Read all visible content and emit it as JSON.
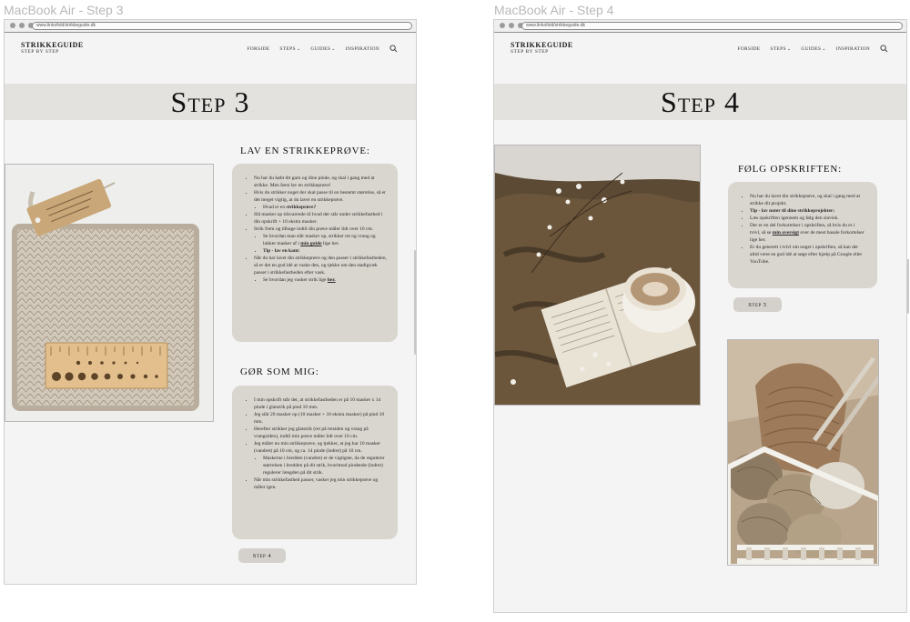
{
  "left": {
    "artboard_title": "MacBook Air - Step 3",
    "url": "www.linkofold/strikkeguide.dk",
    "logo": {
      "main": "STRIKKEGUIDE",
      "sub": "STEP BY STEP"
    },
    "nav": {
      "home": "FORSIDE",
      "steps": "STEPS",
      "guides": "GUIDES",
      "inspiration": "INSPIRATION"
    },
    "banner_title": "Step 3",
    "section1": {
      "title": "LAV EN STRIKKEPRØVE:",
      "items": [
        "Nu har du købt dit garn og dine pinde, og skal i gang med at strikke. Men først lav en strikkeprøve!",
        "Hvis du strikker noget der skal passe til en bestemt størrelse, så er det meget vigtig, at du laver en strikkeprøve.",
        "Slå masker op tilsvarende til hvad der står under strikkefasthed i din opskrift + 10 ekstra masker.",
        "Strik frem og tilbage indtil din prøve måler lidt over 10 cm.",
        "Når du har lavet din strikkeprøve og den passer i strikkefastheden, så er det en god idé at vaske den, og tjekke om den stadigvæk passer i strikkefastheden efter vask."
      ],
      "sub_what_prefix": "Hvad er en ",
      "sub_what_bold": "strikkeprøve?",
      "sub_howto_prefix": "Se hvordan man slår masker op, strikker ret og vrang og lukker masker af i ",
      "sub_howto_link": "min guide",
      "sub_howto_suffix": " lige her.",
      "sub_tip": "Tip - lav en kant:",
      "sub_wash_prefix": "Se hvordan jeg vasker strik lige ",
      "sub_wash_link": "her."
    },
    "section2": {
      "title": "GØR SOM MIG:",
      "items": [
        "I min opskrift står der, at strikkefastheden er på 10 masker x 14 pinde i glatstrik på pind 10 mm.",
        "Jeg slår 20 masker op (10 masker + 10 ekstra masker) på pind 10 mm.",
        "Herefter strikker jeg glatstrik (ret på retsiden og vrang på vrangsiden), indtil min prøve måler lidt over 10 cm.",
        "Jeg måler nu min strikkeprøve, og tjekker, at jeg har 10 masker (vandret) på 10 cm, og ca. 14 pinde (lodret) på 10 cm.",
        "Når min strikkefasthed passer, vasker jeg min strikkeprøve og måler igen."
      ],
      "sub": "Maskerne i bredden (vandret) er de vigtigste, da de regulerer størrelsen i bredden på dit strik, hvorimod pindende (lodret) regulerer længden på dit strik."
    },
    "next_button": "Step 4",
    "gauge_tag": "Yarn label"
  },
  "right": {
    "artboard_title": "MacBook Air - Step 4",
    "url": "www.linkofold/strikkeguide.dk",
    "logo": {
      "main": "STRIKKEGUIDE",
      "sub": "STEP BY STEP"
    },
    "nav": {
      "home": "FORSIDE",
      "steps": "STEPS",
      "guides": "GUIDES",
      "inspiration": "INSPIRATION"
    },
    "banner_title": "Step 4",
    "section1": {
      "title": "FØLG OPSKRIFTEN:",
      "item1": "Nu har du lavet din strikkeprøve, og skal i gang med at strikke dit projekt.",
      "tip": "Tip - lav noter til dine strikkeprojekter:",
      "item3": "Læs opskriften igennem og følg den slavisk.",
      "item4_prefix": "Der er en del forkortelser i opskriften, så hvis du er i tvivl, så se ",
      "item4_link": "min oversigt",
      "item4_suffix": " over de mest basale forkortelser lige her.",
      "item5": "Er du generelt i tvivl om noget i opskriften, så kan det altid være en god idé at søge efter hjælp på Google eller YouTube."
    },
    "next_button": "Step 5"
  },
  "colors": {
    "banner": "#e4e2de",
    "card": "#d9d5cf",
    "button": "#d4d1cc",
    "page": "#f4f4f4"
  }
}
